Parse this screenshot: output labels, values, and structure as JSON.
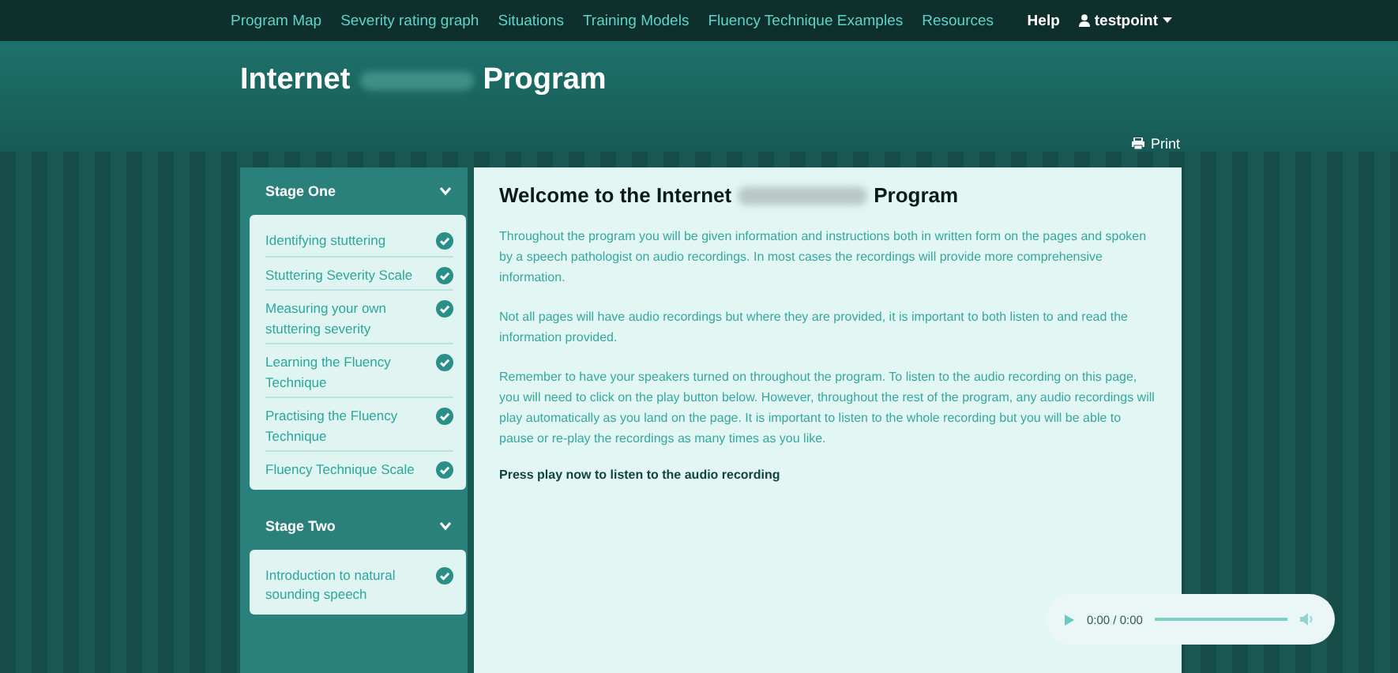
{
  "nav": {
    "links": [
      "Program Map",
      "Severity rating graph",
      "Situations",
      "Training Models",
      "Fluency Technique Examples",
      "Resources"
    ],
    "help": "Help",
    "user": "testpoint"
  },
  "header": {
    "title_start": "Internet",
    "title_end": "Program",
    "print": "Print"
  },
  "sidebar": [
    {
      "title": "Stage One",
      "expanded": true,
      "items": [
        {
          "label": "Identifying stuttering",
          "done": true
        },
        {
          "label": "Stuttering Severity Scale",
          "done": true
        },
        {
          "label": "Measuring your own stuttering severity",
          "done": true
        },
        {
          "label": "Learning the Fluency Technique",
          "done": true
        },
        {
          "label": "Practising the Fluency Technique",
          "done": true
        },
        {
          "label": "Fluency Technique Scale",
          "done": true
        }
      ]
    },
    {
      "title": "Stage Two",
      "expanded": true,
      "items": [
        {
          "label": "Introduction to natural sounding speech",
          "done": true
        }
      ]
    }
  ],
  "main": {
    "title_start": "Welcome to the Internet",
    "title_end": "Program",
    "paragraphs": [
      "Throughout the program you will be given information and instructions both in written form on the pages and spoken by a speech pathologist on audio recordings. In most cases the recordings will provide more comprehensive information.",
      "Not all pages will have audio recordings but where they are provided, it is important to both listen to and read the information provided.",
      "Remember to have your speakers turned on throughout the program. To listen to the audio recording on this page, you will need to click on the play button below. However, throughout the rest of the program, any audio recordings will play automatically as you land on the page. It is important to listen to the whole recording but you will be able to pause or re-play the recordings as many times as you like."
    ],
    "prompt": "Press play now to listen to the audio recording"
  },
  "audio": {
    "time": "0:00 / 0:00"
  }
}
